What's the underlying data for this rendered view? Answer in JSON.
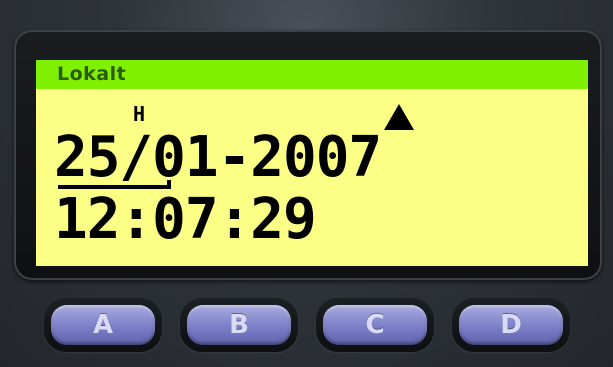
{
  "display": {
    "mode_title": "Lokalt",
    "indicator": "H",
    "date": "25/01-2007",
    "time": "12:07:29",
    "arrow_icon": "up-arrow-icon",
    "colors": {
      "screen_bg": "#fbff85",
      "title_bar": "#7ff000",
      "title_text": "#2c5c0a",
      "digits": "#000000"
    }
  },
  "keys": [
    {
      "label": "A"
    },
    {
      "label": "B"
    },
    {
      "label": "C"
    },
    {
      "label": "D"
    }
  ],
  "key_color": "#7b7fc7"
}
